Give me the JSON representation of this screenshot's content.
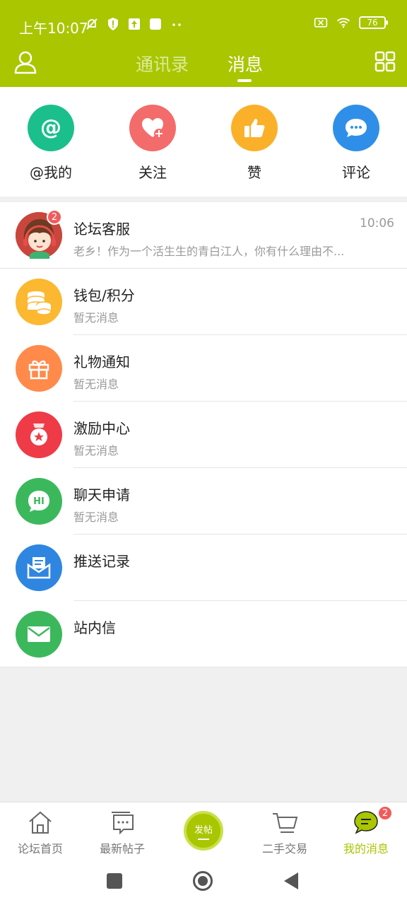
{
  "status_bar": {
    "time": "上午10:07",
    "battery": "76"
  },
  "header": {
    "tabs": [
      {
        "label": "通讯录"
      },
      {
        "label": "消息"
      }
    ]
  },
  "quick_actions": [
    {
      "label": "@我的",
      "icon": "at-icon",
      "color": "#1bbf8c"
    },
    {
      "label": "关注",
      "icon": "heart-plus-icon",
      "color": "#f46b6b"
    },
    {
      "label": "赞",
      "icon": "thumbs-up-icon",
      "color": "#fbb02a"
    },
    {
      "label": "评论",
      "icon": "chat-bubble-icon",
      "color": "#2f8fe8"
    }
  ],
  "messages": [
    {
      "title": "论坛客服",
      "subtitle": "老乡！作为一个活生生的青白江人，你有什么理由不...",
      "time": "10:06",
      "badge": "2"
    },
    {
      "title": "钱包/积分",
      "subtitle": "暂无消息"
    },
    {
      "title": "礼物通知",
      "subtitle": "暂无消息"
    },
    {
      "title": "激励中心",
      "subtitle": "暂无消息"
    },
    {
      "title": "聊天申请",
      "subtitle": "暂无消息",
      "icon_text": "HI"
    },
    {
      "title": "推送记录",
      "subtitle": ""
    },
    {
      "title": "站内信",
      "subtitle": ""
    }
  ],
  "bottom_nav": {
    "items": [
      {
        "label": "论坛首页"
      },
      {
        "label": "最新帖子"
      },
      {
        "label": "二手交易"
      },
      {
        "label": "我的消息",
        "badge": "2"
      }
    ],
    "post_label": "发帖"
  },
  "colors": {
    "brand": "#a9c600",
    "badge": "#f25b5b"
  }
}
